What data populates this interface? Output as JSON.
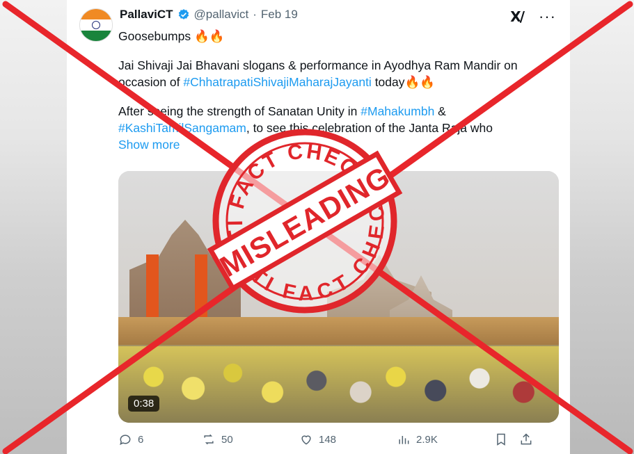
{
  "tweet": {
    "display_name": "PallaviCT",
    "handle": "@pallavict",
    "separator": "·",
    "date": "Feb 19",
    "line1": "Goosebumps 🔥🔥",
    "para2_a": "Jai Shivaji Jai Bhavani slogans & performance in Ayodhya Ram Mandir on occasion of ",
    "para2_hashtag": "#ChhatrapatiShivajiMaharajJayanti",
    "para2_b": " today🔥🔥",
    "para3_a": "After seeing the strength of Sanatan Unity in ",
    "para3_hashtag1": "#Mahakumbh",
    "para3_b": " & ",
    "para3_hashtag2": "#KashiTamilSangamam",
    "para3_c": ", to see this celebration of the Janta Raja who",
    "show_more": "Show more",
    "video_duration": "0:38"
  },
  "actions": {
    "replies": "6",
    "reposts": "50",
    "likes": "148",
    "views": "2.9K"
  },
  "stamp": {
    "top_text": "PTI FACT CHECK",
    "bottom_text": "PTI FACT CHECK",
    "center_text": "MISLEADING",
    "color": "#e0262b"
  },
  "colors": {
    "link": "#1d9bf0",
    "text": "#0f1419",
    "muted": "#536471",
    "cross": "#e8262b"
  },
  "icons": [
    "verified-badge-icon",
    "xai-grok-icon",
    "more-options-icon",
    "reply-icon",
    "repost-icon",
    "like-icon",
    "views-icon",
    "bookmark-icon",
    "share-icon"
  ]
}
